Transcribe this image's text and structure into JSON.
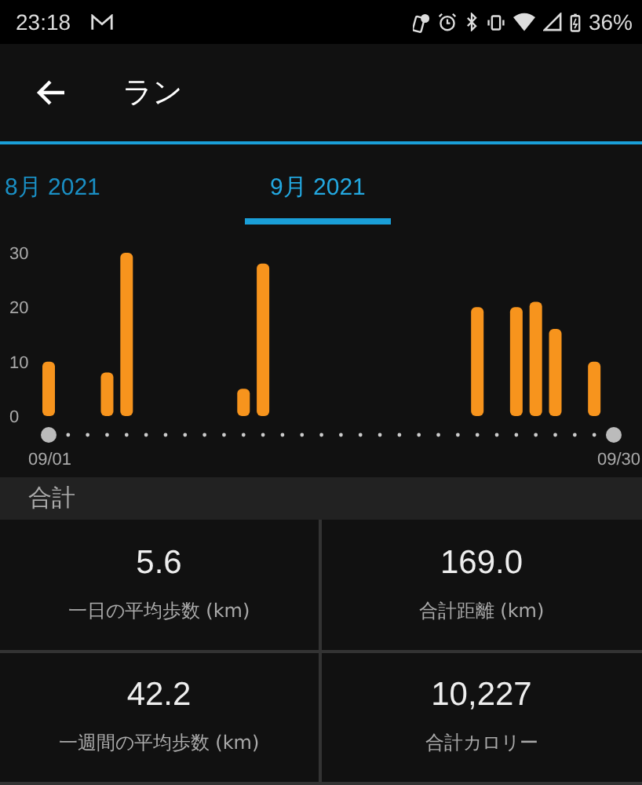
{
  "status_bar": {
    "time": "23:18",
    "battery": "36%"
  },
  "header": {
    "title": "ラン"
  },
  "tabs": [
    {
      "label": "8月 2021",
      "selected": false
    },
    {
      "label": "9月 2021",
      "selected": true
    }
  ],
  "chart_data": {
    "type": "bar",
    "categories": [
      "09/01",
      null,
      null,
      null,
      null,
      null,
      null,
      null,
      null,
      null,
      null,
      null,
      null,
      null,
      null,
      null,
      null,
      null,
      null,
      null,
      null,
      null,
      null,
      null,
      null,
      null,
      null,
      null,
      null,
      "09/30"
    ],
    "values": [
      10,
      0,
      0,
      8,
      30,
      0,
      0,
      0,
      0,
      0,
      5,
      28,
      0,
      0,
      0,
      0,
      0,
      0,
      0,
      0,
      0,
      0,
      20,
      0,
      20,
      21,
      16,
      0,
      10,
      0
    ],
    "ylim": [
      0,
      30
    ],
    "yticks": [
      0,
      10,
      20,
      30
    ]
  },
  "section": {
    "title": "合計"
  },
  "stats": [
    {
      "value": "5.6",
      "label": "一日の平均歩数 (km)"
    },
    {
      "value": "169.0",
      "label": "合計距離 (km)"
    },
    {
      "value": "42.2",
      "label": "一週間の平均歩数 (km)"
    },
    {
      "value": "10,227",
      "label": "合計カロリー"
    }
  ]
}
